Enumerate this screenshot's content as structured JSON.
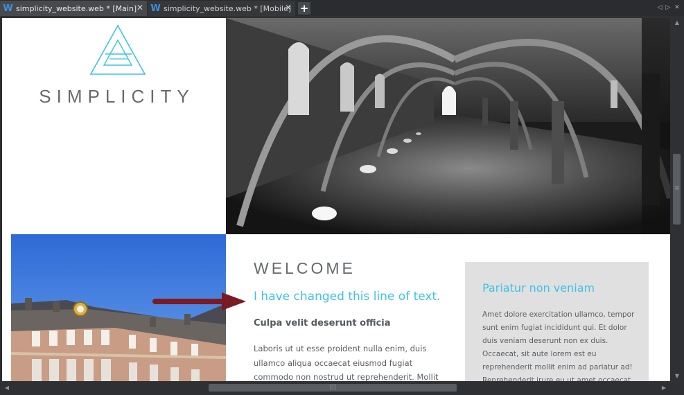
{
  "tabs": [
    {
      "icon": "W",
      "label": "simplicity_website.web * [Main]",
      "close": "✕"
    },
    {
      "icon": "W",
      "label": "simplicity_website.web * [Mobile]",
      "close": "✕"
    }
  ],
  "tabbar": {
    "new_tab": "+",
    "scroll_left": "◁",
    "scroll_right": "▷",
    "close": "✕"
  },
  "page": {
    "logo_text": "SIMPLICITY",
    "welcome": "WELCOME",
    "changed_line": "I have changed this line of text.",
    "subheading": "Culpa velit deserunt officia",
    "paragraph": "Laboris ut ut esse proident nulla enim, duis ullamco aliqua occaecat eiusmod fugiat commodo non nostrud ut reprehenderit. Mollit",
    "sidebox": {
      "title": "Pariatur non veniam",
      "text": "Amet dolore exercitation ullamco, tempor sunt enim fugiat incididunt qui. Et dolor duis veniam deserunt non ex duis. Occaecat, sit aute lorem est eu reprehenderit mollit enim ad pariatur ad! Reprehenderit irure eu ut amet occaecat"
    }
  },
  "colors": {
    "accent": "#3fc1e4",
    "arrow": "#7a1a22",
    "text_gray": "#666a6e",
    "sidebox_bg": "#e0e0e0",
    "app_bg": "#2b2d30"
  },
  "icons": [
    "w-document-icon",
    "close-icon",
    "plus-icon",
    "triangle-a-logo-icon",
    "arrow-right-icon",
    "scroll-arrow-icon"
  ]
}
